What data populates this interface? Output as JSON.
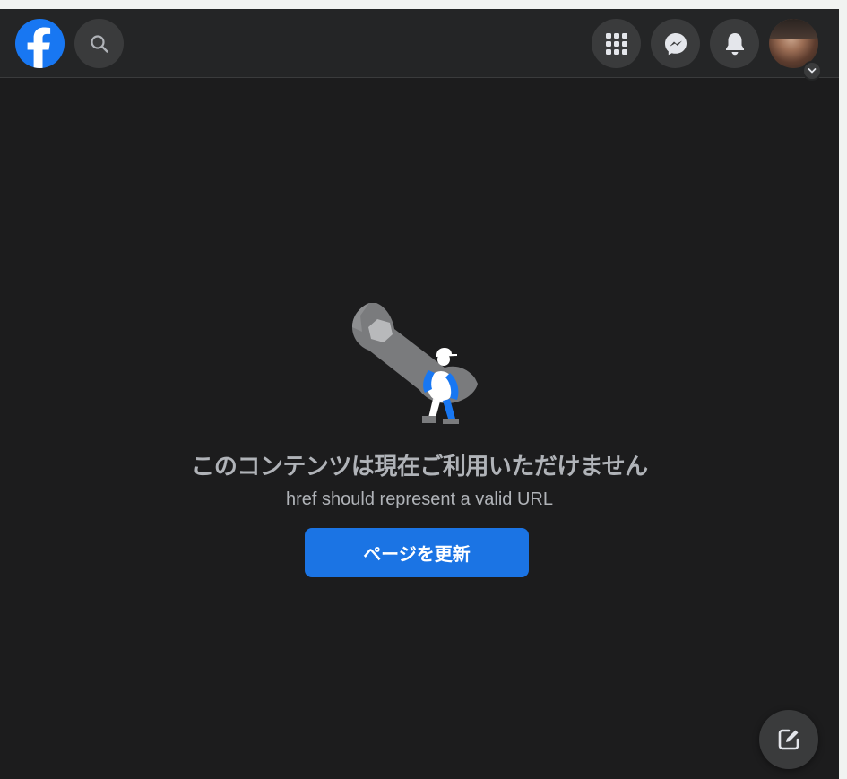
{
  "header": {
    "logo_icon": "facebook-logo-icon",
    "buttons": [
      {
        "name": "search-button",
        "icon": "search-icon"
      },
      {
        "name": "menu-button",
        "icon": "grid-menu-icon"
      },
      {
        "name": "messenger-button",
        "icon": "messenger-icon"
      },
      {
        "name": "notifications-button",
        "icon": "bell-icon"
      },
      {
        "name": "account-button",
        "icon": "chevron-down-icon"
      }
    ]
  },
  "error": {
    "title": "このコンテンツは現在ご利用いただけません",
    "message": "href should represent a valid URL",
    "reload_label": "ページを更新"
  },
  "fab": {
    "icon": "compose-icon"
  },
  "colors": {
    "background": "#1c1c1d",
    "topbar": "#242526",
    "button": "#3a3b3c",
    "accent": "#1b74e4",
    "text_secondary": "#b0b3b8"
  }
}
